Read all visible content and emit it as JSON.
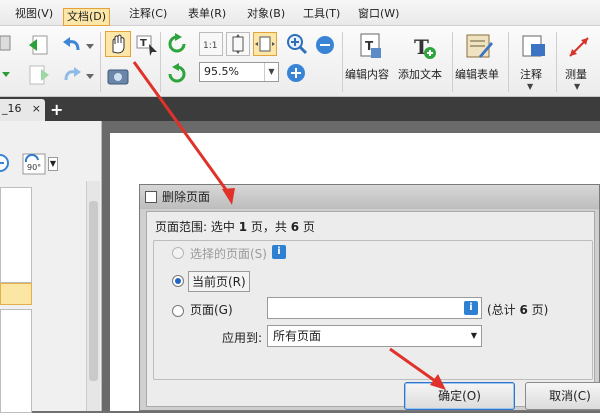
{
  "menubar": {
    "items": [
      {
        "label": "视图(V)",
        "active": false
      },
      {
        "label": "文档(D)",
        "active": true
      },
      {
        "label": "注释(C)",
        "active": false
      },
      {
        "label": "表单(R)",
        "active": false
      },
      {
        "label": "对象(B)",
        "active": false
      },
      {
        "label": "工具(T)",
        "active": false
      },
      {
        "label": "窗口(W)",
        "active": false
      }
    ]
  },
  "toolbar": {
    "zoom_value": "95.5%",
    "edit_content_label": "编辑内容",
    "add_text_label": "添加文本",
    "edit_form_label": "编辑表单",
    "annotate_label": "注释",
    "measure_label": "测量"
  },
  "tabs": {
    "active_tab_label": "_16",
    "close_glyph": "×",
    "add_glyph": "+"
  },
  "sidepane": {
    "rotate_label": "90°"
  },
  "dialog": {
    "title": "删除页面",
    "range_prefix": "页面范围: 选中 ",
    "range_selected": "1",
    "range_mid": " 页，共 ",
    "range_total": "6",
    "range_suffix": " 页",
    "option_selected_pages": "选择的页面(S)",
    "option_current_page": "当前页(R)",
    "option_pages": "页面(G)",
    "pages_input_value": "",
    "total_prefix": "(总计 ",
    "total_count": "6",
    "total_suffix": " 页)",
    "apply_to_label": "应用到:",
    "apply_to_value": "所有页面",
    "ok_label": "确定(O)",
    "cancel_label": "取消(C)"
  },
  "colors": {
    "highlight_arrow": "#e0322b",
    "active_menu_bg": "#fde7a8",
    "accent_blue": "#2f7fd2"
  }
}
